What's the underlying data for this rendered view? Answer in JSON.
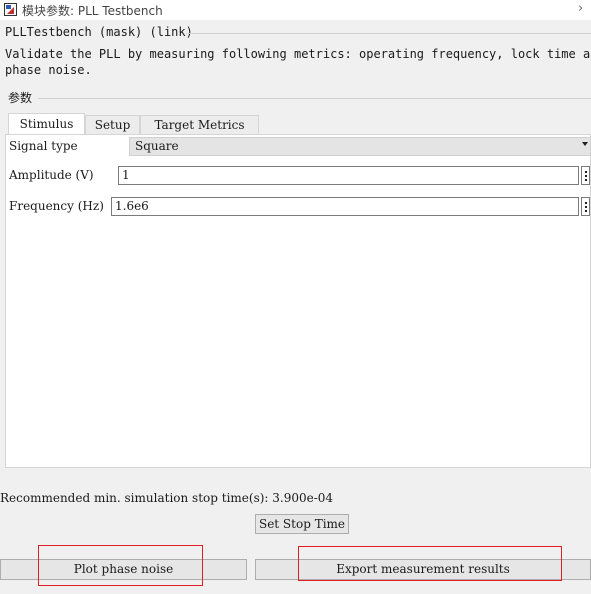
{
  "window": {
    "title": "模块参数: PLL Testbench"
  },
  "mask": {
    "header": "PLLTestbench (mask) (link)",
    "description_line1": "Validate the PLL by measuring following metrics: operating frequency, lock time and",
    "description_line2": "phase noise."
  },
  "params": {
    "group_label": "参数"
  },
  "tabs": [
    {
      "label": "Stimulus",
      "active": true
    },
    {
      "label": "Setup",
      "active": false
    },
    {
      "label": "Target Metrics",
      "active": false
    }
  ],
  "stimulus": {
    "signal_type": {
      "label": "Signal type",
      "value": "Square"
    },
    "amplitude": {
      "label": "Amplitude (V)",
      "value": "1"
    },
    "frequency": {
      "label": "Frequency (Hz)",
      "value": "1.6e6"
    }
  },
  "footer": {
    "recommendation": "Recommended min. simulation stop time(s): 3.900e-04",
    "set_stop_time": "Set Stop Time",
    "plot_phase_noise": "Plot phase noise",
    "export_results": "Export measurement results"
  },
  "colors": {
    "highlight": "#e02020",
    "panel": "#ffffff",
    "background": "#f0f0f0"
  }
}
